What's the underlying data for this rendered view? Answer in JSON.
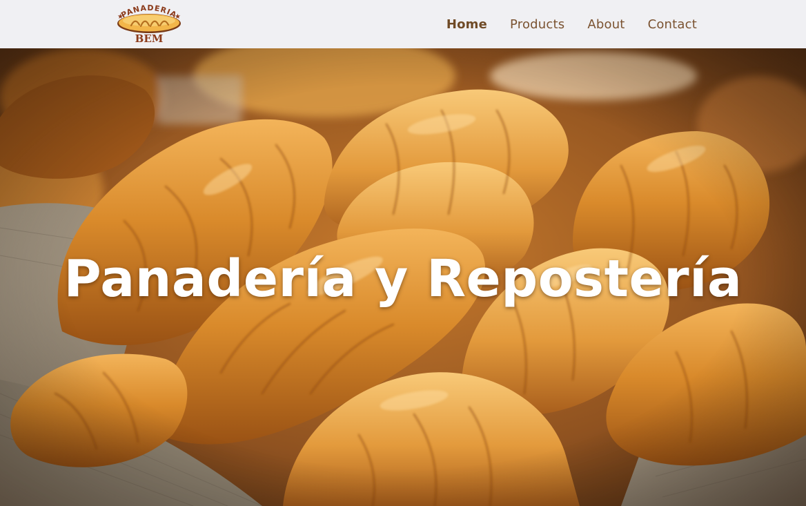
{
  "brand": {
    "logo_text_top": "PANADERIA",
    "logo_text_bottom": "BEM"
  },
  "nav": {
    "items": [
      {
        "label": "Home",
        "active": true
      },
      {
        "label": "Products",
        "active": false
      },
      {
        "label": "About",
        "active": false
      },
      {
        "label": "Contact",
        "active": false
      }
    ]
  },
  "hero": {
    "title": "Panadería y Repostería",
    "image_icon": "croissant-basket-photo"
  },
  "colors": {
    "navbar_bg": "#f0f0f3",
    "nav_text": "#7a5230",
    "hero_title": "#ffffff",
    "logo_bread": "#f2b64a",
    "logo_text": "#8b3a1a"
  }
}
